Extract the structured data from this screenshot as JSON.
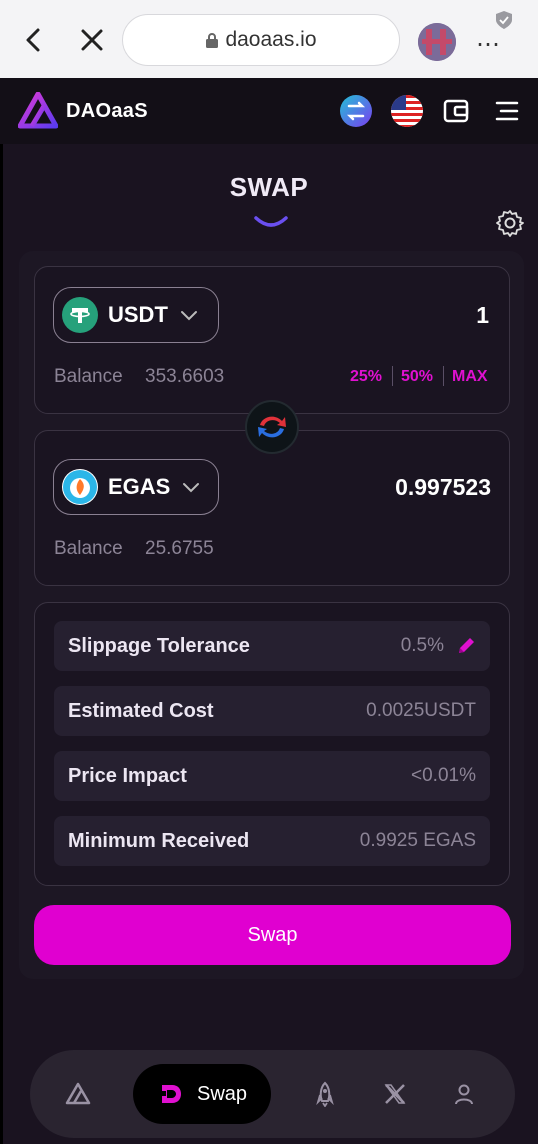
{
  "browser": {
    "url": "daoaas.io"
  },
  "header": {
    "brand": "DAOaaS"
  },
  "page": {
    "title": "SWAP"
  },
  "from": {
    "symbol": "USDT",
    "amount": "1",
    "balance_label": "Balance",
    "balance": "353.6603",
    "pct_25": "25%",
    "pct_50": "50%",
    "pct_max": "MAX",
    "icon": "tether-icon"
  },
  "to": {
    "symbol": "EGAS",
    "amount": "0.997523",
    "balance_label": "Balance",
    "balance": "25.6755",
    "icon": "egas-icon"
  },
  "info": {
    "slippage_label": "Slippage Tolerance",
    "slippage_value": "0.5%",
    "cost_label": "Estimated Cost",
    "cost_value": "0.0025USDT",
    "impact_label": "Price Impact",
    "impact_value": "<0.01%",
    "min_label": "Minimum Received",
    "min_value": "0.9925 EGAS"
  },
  "actions": {
    "swap_label": "Swap"
  },
  "nav": {
    "active_label": "Swap"
  },
  "colors": {
    "accent": "#e000d0",
    "background": "#1a1320",
    "tether": "#26a17b"
  }
}
